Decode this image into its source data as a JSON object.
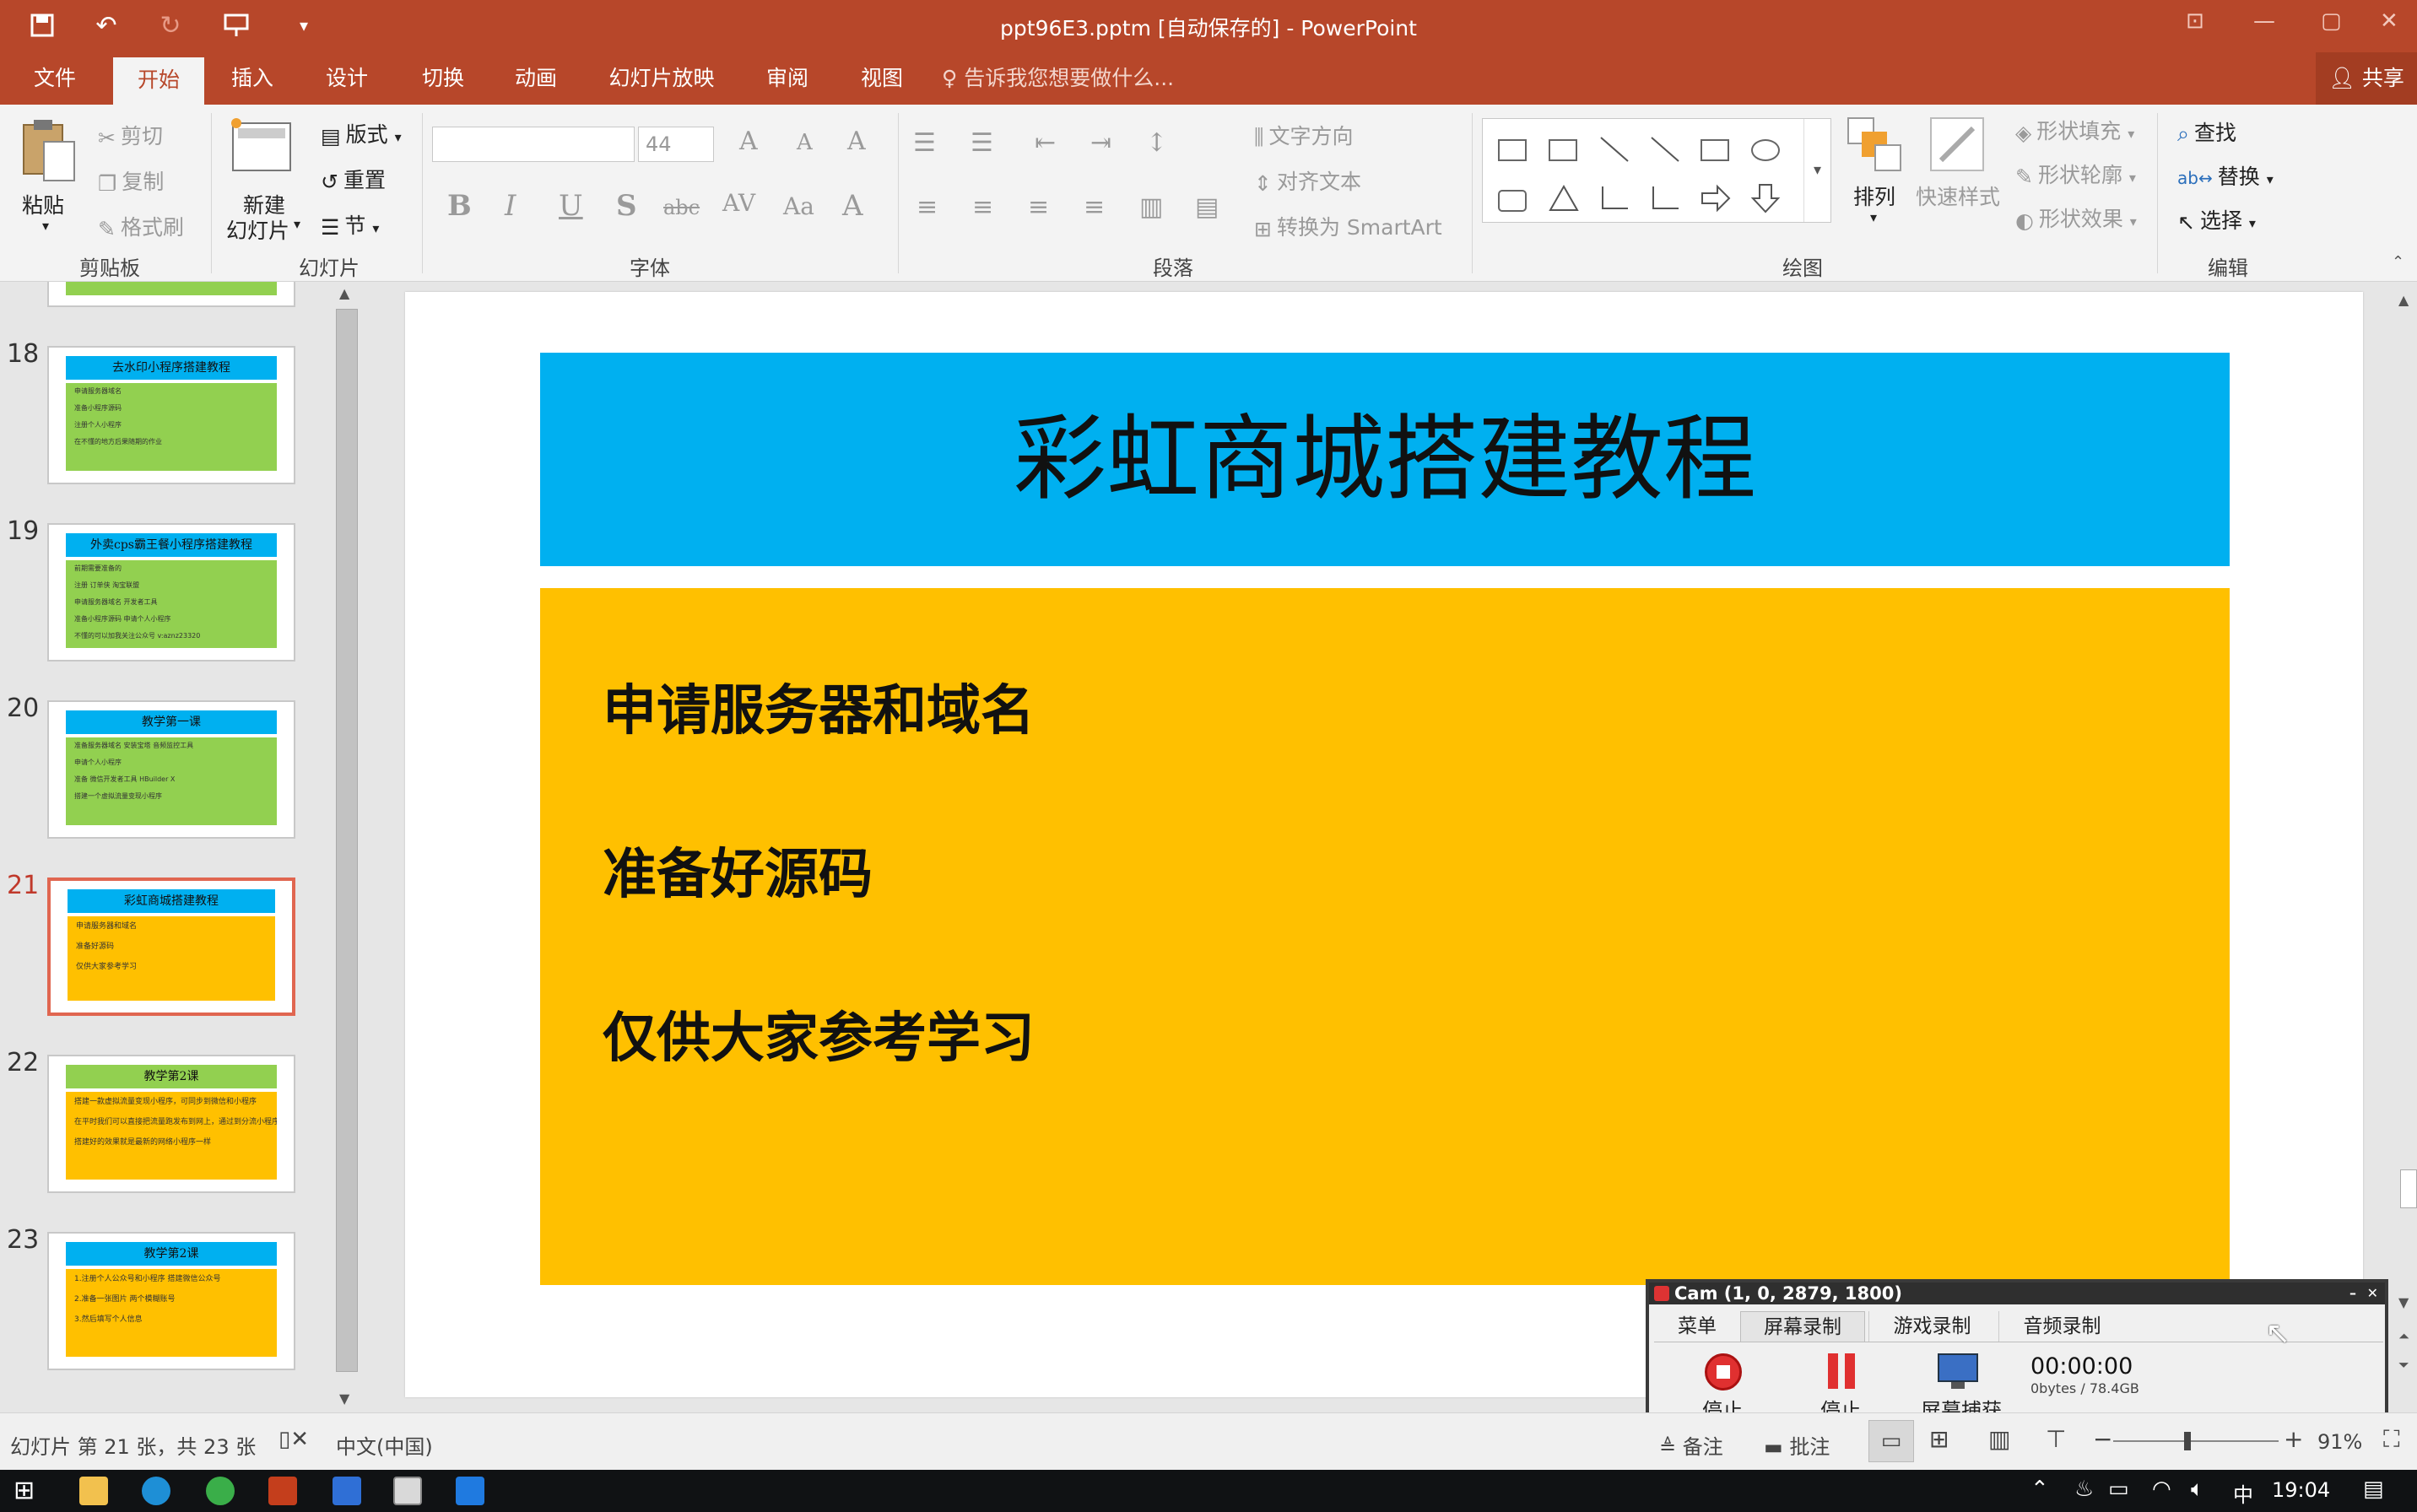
{
  "window": {
    "title": "ppt96E3.pptm [自动保存的] - PowerPoint",
    "share_label": "共享"
  },
  "menu_tabs": [
    "文件",
    "开始",
    "插入",
    "设计",
    "切换",
    "动画",
    "幻灯片放映",
    "审阅",
    "视图"
  ],
  "active_tab": "开始",
  "tell_me": "告诉我您想要做什么...",
  "ribbon": {
    "clipboard": {
      "paste": "粘贴",
      "cut": "剪切",
      "copy": "复制",
      "format_painter": "格式刷",
      "group": "剪贴板"
    },
    "slides": {
      "new_slide_1": "新建",
      "new_slide_2": "幻灯片",
      "layout": "版式",
      "reset": "重置",
      "section": "节",
      "group": "幻灯片"
    },
    "font": {
      "font_name": "",
      "font_size": "44",
      "group": "字体"
    },
    "paragraph": {
      "text_direction": "文字方向",
      "align_text": "对齐文本",
      "smartart": "转换为 SmartArt",
      "group": "段落"
    },
    "drawing": {
      "arrange": "排列",
      "quick_styles": "快速样式",
      "shape_fill": "形状填充",
      "shape_outline": "形状轮廓",
      "shape_effects": "形状效果",
      "group": "绘图"
    },
    "editing": {
      "find": "查找",
      "replace": "替换",
      "select": "选择",
      "group": "编辑"
    }
  },
  "thumbnails": [
    {
      "num": "18",
      "title": "去水印小程序搭建教程",
      "title_color": "#00b0f0",
      "body_color": "#92d050",
      "lines": [
        "申请服务器域名",
        "准备小程序源码",
        "注册个人小程序",
        "在不懂的地方后果随期的作业"
      ],
      "selected": false
    },
    {
      "num": "19",
      "title": "外卖cps霸王餐小程序搭建教程",
      "title_color": "#00b0f0",
      "body_color": "#92d050",
      "lines": [
        "前期需要准备的",
        "注册 订单侠  淘宝联盟",
        "申请服务器域名  开发者工具",
        "准备小程序源码   申请个人小程序",
        "不懂的可以加我关注公众号 v:aznz23320"
      ],
      "selected": false
    },
    {
      "num": "20",
      "title": "教学第一课",
      "title_color": "#00b0f0",
      "body_color": "#92d050",
      "lines": [
        "准备服务器域名  安装宝塔  音频监控工具",
        "申请个人小程序",
        "准备 微信开发者工具  HBuilder X",
        "搭建一个虚拟流量变现小程序"
      ],
      "selected": false
    },
    {
      "num": "21",
      "title": "彩虹商城搭建教程",
      "title_color": "#00b0f0",
      "body_color": "#ffc000",
      "lines": [
        "申请服务器和域名",
        "准备好源码",
        "仅供大家参考学习"
      ],
      "selected": true
    },
    {
      "num": "22",
      "title": "教学第2课",
      "title_color": "#92d050",
      "body_color": "#ffc000",
      "lines": [
        "搭建一款虚拟流量变现小程序，可同步到微信和小程序",
        "在平时我们可以直接把流量跑发布到网上，通过到分流小程序",
        "搭建好的效果就是最新的网络小程序一样"
      ],
      "selected": false
    },
    {
      "num": "23",
      "title": "教学第2课",
      "title_color": "#00b0f0",
      "body_color": "#ffc000",
      "lines": [
        "1.注册个人公众号和小程序    搭建微信公众号",
        "2.准备一张图片    两个模糊账号",
        "3.然后填写个人信息"
      ],
      "selected": false
    }
  ],
  "slide": {
    "title": "彩虹商城搭建教程",
    "title_bg": "#00b0f0",
    "body_bg": "#ffc000",
    "lines": [
      "申请服务器和域名",
      "准备好源码",
      "仅供大家参考学习"
    ]
  },
  "status": {
    "slide_info": "幻灯片 第 21 张，共 23 张",
    "language": "中文(中国)",
    "notes": "备注",
    "comments": "批注",
    "zoom": "91%",
    "zoom_level": 0.91
  },
  "recorder": {
    "title": "Cam (1, 0, 2879, 1800)",
    "tabs": [
      "菜单",
      "屏幕录制",
      "游戏录制",
      "音频录制"
    ],
    "active_tab": "屏幕录制",
    "stop1": "停止",
    "stop2": "停止",
    "capture": "屏幕捕获",
    "time": "00:00:00",
    "size": "0bytes / 78.4GB"
  },
  "taskbar": {
    "clock": "19:04",
    "ime": "中"
  }
}
